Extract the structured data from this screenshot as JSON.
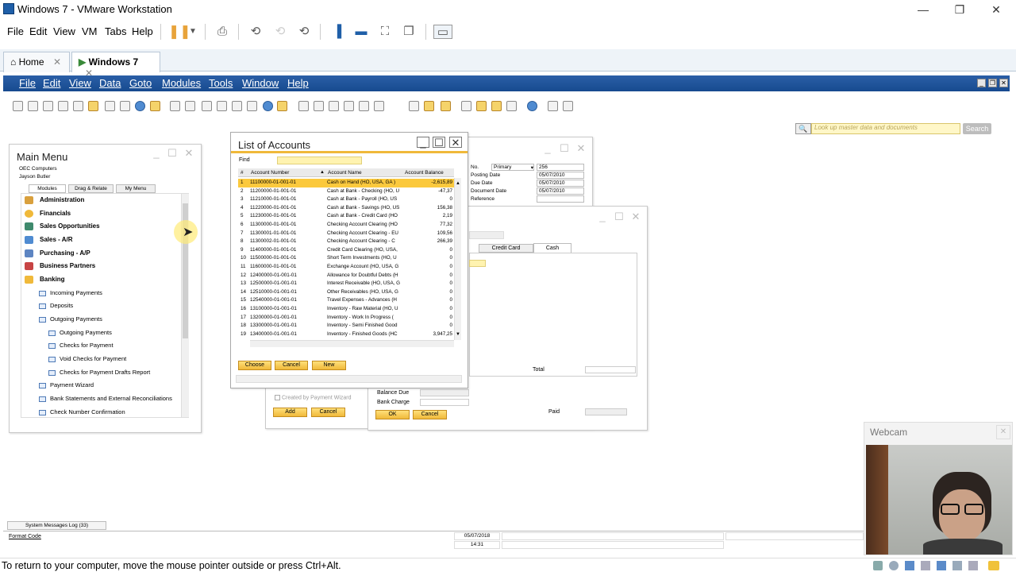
{
  "vm": {
    "title": "Windows 7 - VMware Workstation",
    "menu": [
      "File",
      "Edit",
      "View",
      "VM",
      "Tabs",
      "Help"
    ],
    "tabs": [
      {
        "label": "Home"
      },
      {
        "label": "Windows 7"
      }
    ],
    "status_message": "To return to your computer, move the mouse pointer outside or press Ctrl+Alt."
  },
  "sap": {
    "menu": [
      "File",
      "Edit",
      "View",
      "Data",
      "Goto",
      "Modules",
      "Tools",
      "Window",
      "Help"
    ],
    "search_placeholder": "Look up master data and documents",
    "search_button": "Search",
    "main_menu": {
      "title": "Main Menu",
      "company": "OEC Computers",
      "user": "Jayson Butler",
      "tabs": [
        "Modules",
        "Drag & Relate",
        "My Menu"
      ],
      "modules": [
        "Administration",
        "Financials",
        "Sales Opportunities",
        "Sales - A/R",
        "Purchasing - A/P",
        "Business Partners",
        "Banking"
      ],
      "banking_items": [
        {
          "label": "Incoming Payments",
          "level": 1
        },
        {
          "label": "Deposits",
          "level": 1
        },
        {
          "label": "Outgoing Payments",
          "level": 1
        },
        {
          "label": "Outgoing Payments",
          "level": 2
        },
        {
          "label": "Checks for Payment",
          "level": 2
        },
        {
          "label": "Void Checks for Payment",
          "level": 2
        },
        {
          "label": "Checks for Payment Drafts Report",
          "level": 2
        },
        {
          "label": "Payment Wizard",
          "level": 1
        },
        {
          "label": "Bank Statements and External Reconciliations",
          "level": 1
        },
        {
          "label": "Check Number Confirmation",
          "level": 1
        }
      ]
    },
    "list_of_accounts": {
      "title": "List of Accounts",
      "find_label": "Find",
      "columns": [
        "#",
        "Account Number",
        "Account Name",
        "Account Balance"
      ],
      "rows": [
        [
          "1",
          "11100000-01-001-01",
          "Cash on Hand (HO, USA, GA )",
          "-2,615,89"
        ],
        [
          "2",
          "11200000-01-001-01",
          "Cash at Bank - Checking (HO, U",
          "-47,37"
        ],
        [
          "3",
          "11210000-01-001-01",
          "Cash at Bank - Payroll (HO, US",
          "0"
        ],
        [
          "4",
          "11220000-01-001-01",
          "Cash at Bank - Savings (HO, US",
          "156,38"
        ],
        [
          "5",
          "11230000-01-001-01",
          "Cash at Bank - Credit Card (HO",
          "2,19"
        ],
        [
          "6",
          "11300000-01-001-01",
          "Checking Account Clearing (HO",
          "77,32"
        ],
        [
          "7",
          "11300001-01-001-01",
          "Checking Account Clearing - EU",
          "109,56"
        ],
        [
          "8",
          "11300002-01-001-01",
          "Checking Account Clearing - C",
          "266,39"
        ],
        [
          "9",
          "11400000-01-001-01",
          "Credit Card Clearing (HO, USA,",
          "0"
        ],
        [
          "10",
          "11500000-01-001-01",
          "Short Term Investments (HO, U",
          "0"
        ],
        [
          "11",
          "11600000-01-001-01",
          "Exchange Account (HO, USA, G",
          "0"
        ],
        [
          "12",
          "12400000-01-001-01",
          "Allowance for Doubtful Debts (H",
          "0"
        ],
        [
          "13",
          "12500000-01-001-01",
          "Interest Receivable (HO, USA, G",
          "0"
        ],
        [
          "14",
          "12510000-01-001-01",
          "Other Receivables (HO, USA, G",
          "0"
        ],
        [
          "15",
          "12540000-01-001-01",
          "Travel Expenses - Advances (H",
          "0"
        ],
        [
          "16",
          "13100000-01-001-01",
          "Inventory - Raw Material (HO, U",
          "0"
        ],
        [
          "17",
          "13200000-01-001-01",
          "Inventory - Work In Progress (",
          "0"
        ],
        [
          "18",
          "13300000-01-001-01",
          "Inventory - Semi Finished Good",
          "0"
        ],
        [
          "19",
          "13400000-01-001-01",
          "Inventory - Finished Goods (HC",
          "3,947,25"
        ]
      ],
      "buttons": [
        "Choose",
        "Cancel",
        "New"
      ]
    },
    "outgoing_payment": {
      "fields": [
        {
          "label": "No.",
          "series": "Primary",
          "value": "256"
        },
        {
          "label": "Posting Date",
          "value": "05/07/2010"
        },
        {
          "label": "Due Date",
          "value": "05/07/2010"
        },
        {
          "label": "Document Date",
          "value": "05/07/2010"
        },
        {
          "label": "Reference",
          "value": ""
        }
      ],
      "created_by_wizard": "Created by Payment Wizard",
      "buttons": [
        "Add",
        "Cancel"
      ]
    },
    "payment_means": {
      "tabs": [
        "Credit Card",
        "Cash"
      ],
      "total_label": "Total",
      "balance_due_label": "Balance Due",
      "bank_charge_label": "Bank Charge",
      "paid_label": "Paid",
      "buttons": [
        "OK",
        "Cancel"
      ]
    },
    "bottom": {
      "system_messages": "System Messages Log (33)",
      "format_code": "Format Code",
      "date": "05/07/2018",
      "time": "14:31"
    }
  },
  "webcam_label": "Webcam"
}
